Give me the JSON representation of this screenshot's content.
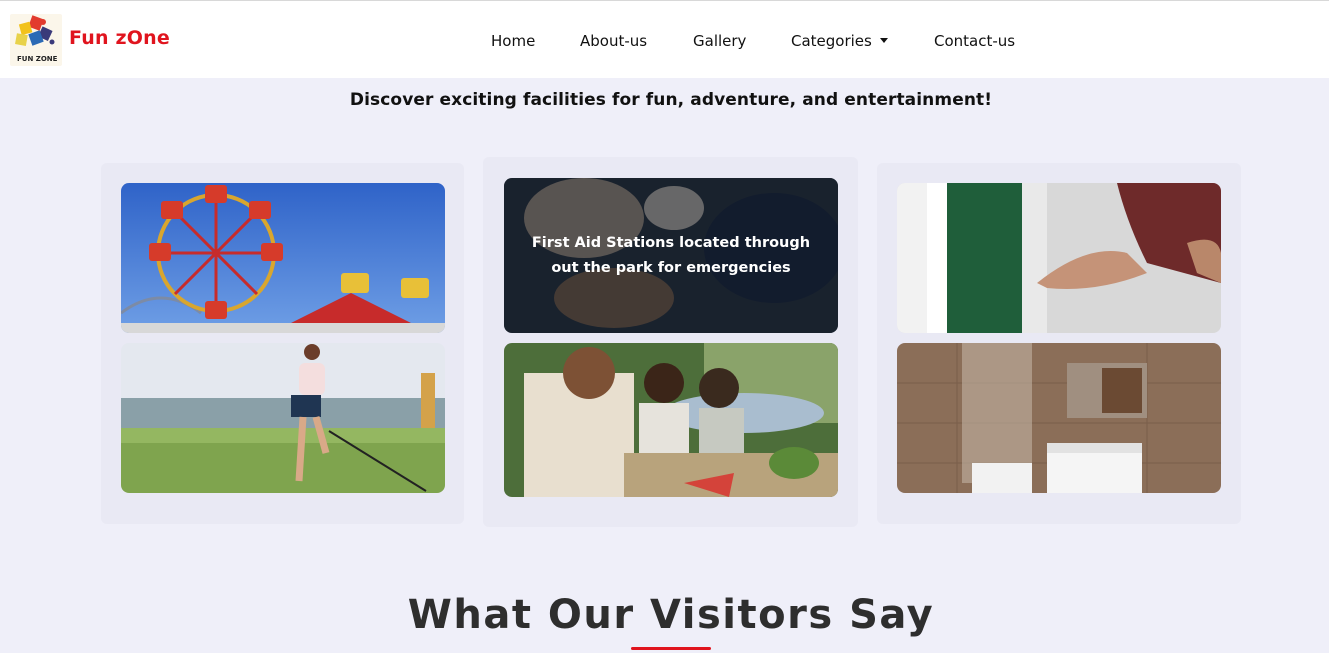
{
  "brand": {
    "logo_text": "FUN ZONE",
    "name": "Fun zOne"
  },
  "nav": {
    "items": [
      "Home",
      "About-us",
      "Gallery",
      "Categories",
      "Contact-us"
    ]
  },
  "hero": {
    "tagline": "Discover exciting facilities for fun, adventure, and entertainment!"
  },
  "facilities": {
    "overlay_text": "First Aid Stations located through out the park for emergencies"
  },
  "testimonials": {
    "title": "What Our Visitors Say"
  },
  "colors": {
    "brand": "#e0141e",
    "page_bg": "#efeff9",
    "panel_bg": "#e9e9f4",
    "nav_bg": "#ffffff"
  }
}
